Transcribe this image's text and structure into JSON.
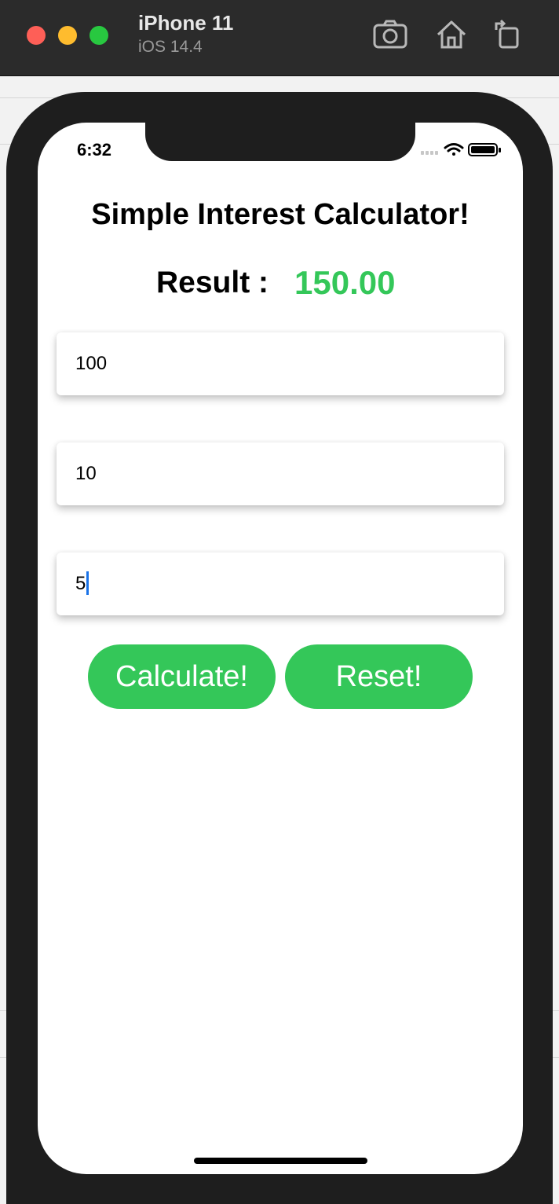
{
  "simulator": {
    "device_name": "iPhone 11",
    "os_version": "iOS 14.4",
    "toolbar_icons": [
      "screenshot-icon",
      "home-icon",
      "rotate-icon"
    ]
  },
  "status_bar": {
    "time": "6:32"
  },
  "app": {
    "title": "Simple Interest Calculator!",
    "result_label": "Result :",
    "result_value": "150.00",
    "fields": [
      {
        "value": "100"
      },
      {
        "value": "10"
      },
      {
        "value": "5"
      }
    ],
    "buttons": {
      "calculate": "Calculate!",
      "reset": "Reset!"
    }
  },
  "colors": {
    "accent": "#34c759",
    "caret": "#1a73e8",
    "titlebar": "#2b2b2b"
  }
}
